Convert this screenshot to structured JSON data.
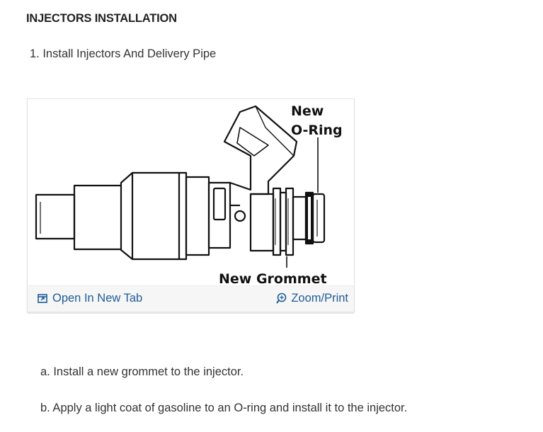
{
  "section": {
    "title": "INJECTORS INSTALLATION"
  },
  "step": {
    "text": "1. Install Injectors And Delivery Pipe"
  },
  "figure": {
    "label_oring_line1": "New",
    "label_oring_line2": "O-Ring",
    "label_grommet": "New Grommet",
    "open_tab_label": "Open In New Tab",
    "zoom_print_label": "Zoom/Print",
    "icons": [
      "open-in-new-tab-icon",
      "zoom-icon"
    ],
    "link_color": "#1f5c99"
  },
  "instructions": {
    "a": "a. Install a new grommet to the injector.",
    "b": "b. Apply a light coat of gasoline to an O-ring and install it to the injector."
  }
}
